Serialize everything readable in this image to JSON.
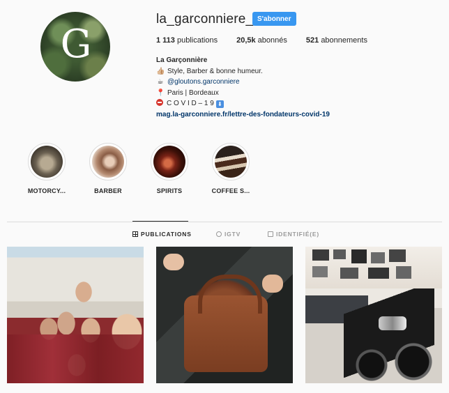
{
  "profile": {
    "avatar_letter": "G",
    "username": "la_garconniere_",
    "follow_label": "S'abonner",
    "stats": [
      {
        "count": "1 113",
        "label": "publications"
      },
      {
        "count": "20,5k",
        "label": "abonnés"
      },
      {
        "count": "521",
        "label": "abonnements"
      }
    ],
    "bio": {
      "name": "La Garçonnière",
      "line1_emoji": "👍🏼",
      "line1": "Style, Barber & bonne humeur.",
      "line2_emoji": "☕",
      "line2": "@gloutons.garconniere",
      "line3_emoji": "📍",
      "line3": "Paris | Bordeaux",
      "line4": "C O V I D – 1 9",
      "line4_badge": "⬇",
      "link": "mag.la-garconniere.fr/lettre-des-fondateurs-covid-19"
    }
  },
  "highlights": [
    {
      "label": "MOTORCY..."
    },
    {
      "label": "BARBER"
    },
    {
      "label": "SPIRITS"
    },
    {
      "label": "COFFEE S..."
    }
  ],
  "tabs": [
    {
      "label": "PUBLICATIONS",
      "icon": "grid-icon",
      "active": true
    },
    {
      "label": "IGTV",
      "icon": "igtv-icon",
      "active": false
    },
    {
      "label": "IDENTIFIÉ(E)",
      "icon": "tagged-icon",
      "active": false
    }
  ],
  "colors": {
    "accent": "#3897f0",
    "link": "#003569",
    "background": "#fafafa"
  }
}
